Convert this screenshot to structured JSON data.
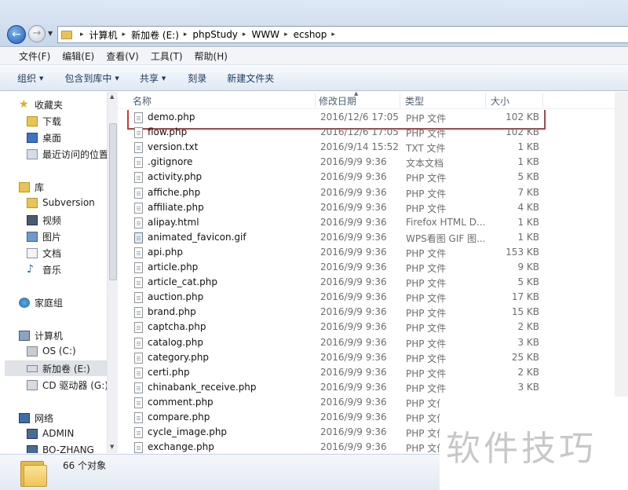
{
  "breadcrumb": [
    "计算机",
    "新加卷 (E:)",
    "phpStudy",
    "WWW",
    "ecshop"
  ],
  "menu": [
    "文件(F)",
    "编辑(E)",
    "查看(V)",
    "工具(T)",
    "帮助(H)"
  ],
  "toolbar": {
    "organize": "组织",
    "include_library": "包含到库中",
    "share": "共享",
    "burn": "刻录",
    "new_folder": "新建文件夹"
  },
  "nav": {
    "favorites": "收藏夹",
    "downloads": "下载",
    "desktop": "桌面",
    "recent": "最近访问的位置",
    "libraries": "库",
    "subversion": "Subversion",
    "videos": "视频",
    "pictures": "图片",
    "documents": "文档",
    "music": "音乐",
    "homegroup": "家庭组",
    "computer": "计算机",
    "drive_c": "OS (C:)",
    "drive_e": "新加卷 (E:)",
    "drive_g": "CD 驱动器 (G:)",
    "network": "网络",
    "net_admin": "ADMIN",
    "net_bo": "BO-ZHANG"
  },
  "columns": {
    "name": "名称",
    "modified": "修改日期",
    "type": "类型",
    "size": "大小"
  },
  "files": [
    {
      "name": "demo.php",
      "date": "2016/12/6 17:05",
      "type": "PHP 文件",
      "size": "102 KB"
    },
    {
      "name": "flow.php",
      "date": "2016/12/6 17:05",
      "type": "PHP 文件",
      "size": "102 KB"
    },
    {
      "name": "version.txt",
      "date": "2016/9/14 15:52",
      "type": "TXT 文件",
      "size": "1 KB"
    },
    {
      "name": ".gitignore",
      "date": "2016/9/9 9:36",
      "type": "文本文档",
      "size": "1 KB"
    },
    {
      "name": "activity.php",
      "date": "2016/9/9 9:36",
      "type": "PHP 文件",
      "size": "5 KB"
    },
    {
      "name": "affiche.php",
      "date": "2016/9/9 9:36",
      "type": "PHP 文件",
      "size": "7 KB"
    },
    {
      "name": "affiliate.php",
      "date": "2016/9/9 9:36",
      "type": "PHP 文件",
      "size": "4 KB"
    },
    {
      "name": "alipay.html",
      "date": "2016/9/9 9:36",
      "type": "Firefox HTML D...",
      "size": "1 KB"
    },
    {
      "name": "animated_favicon.gif",
      "date": "2016/9/9 9:36",
      "type": "WPS看图 GIF 图...",
      "size": "1 KB"
    },
    {
      "name": "api.php",
      "date": "2016/9/9 9:36",
      "type": "PHP 文件",
      "size": "153 KB"
    },
    {
      "name": "article.php",
      "date": "2016/9/9 9:36",
      "type": "PHP 文件",
      "size": "9 KB"
    },
    {
      "name": "article_cat.php",
      "date": "2016/9/9 9:36",
      "type": "PHP 文件",
      "size": "5 KB"
    },
    {
      "name": "auction.php",
      "date": "2016/9/9 9:36",
      "type": "PHP 文件",
      "size": "17 KB"
    },
    {
      "name": "brand.php",
      "date": "2016/9/9 9:36",
      "type": "PHP 文件",
      "size": "15 KB"
    },
    {
      "name": "captcha.php",
      "date": "2016/9/9 9:36",
      "type": "PHP 文件",
      "size": "2 KB"
    },
    {
      "name": "catalog.php",
      "date": "2016/9/9 9:36",
      "type": "PHP 文件",
      "size": "3 KB"
    },
    {
      "name": "category.php",
      "date": "2016/9/9 9:36",
      "type": "PHP 文件",
      "size": "25 KB"
    },
    {
      "name": "certi.php",
      "date": "2016/9/9 9:36",
      "type": "PHP 文件",
      "size": "2 KB"
    },
    {
      "name": "chinabank_receive.php",
      "date": "2016/9/9 9:36",
      "type": "PHP 文件",
      "size": "3 KB"
    },
    {
      "name": "comment.php",
      "date": "2016/9/9 9:36",
      "type": "PHP 文件",
      "size": ""
    },
    {
      "name": "compare.php",
      "date": "2016/9/9 9:36",
      "type": "PHP 文件",
      "size": ""
    },
    {
      "name": "cycle_image.php",
      "date": "2016/9/9 9:36",
      "type": "PHP 文件",
      "size": ""
    },
    {
      "name": "exchange.php",
      "date": "2016/9/9 9:36",
      "type": "PHP 文件",
      "size": ""
    }
  ],
  "status": {
    "count": "66 个对象"
  },
  "watermark": "软件技巧",
  "colors": {
    "highlight": "#d23a3a",
    "toolbar_text": "#1e395b"
  }
}
